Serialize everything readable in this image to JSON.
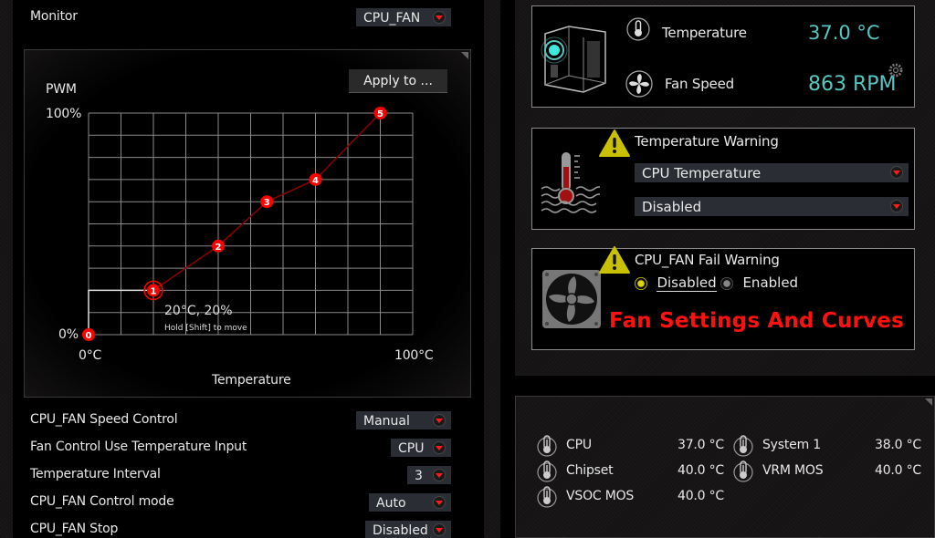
{
  "monitor": {
    "label": "Monitor",
    "selected": "CPU_FAN"
  },
  "curve_panel": {
    "apply_button": "Apply to ...",
    "tooltip_value": "20°C, 20%",
    "tooltip_hint": "Hold [Shift] to move"
  },
  "chart_data": {
    "type": "line",
    "title": "",
    "xlabel": "Temperature",
    "ylabel": "PWM",
    "x_unit": "°C",
    "y_unit": "%",
    "xlim": [
      0,
      100
    ],
    "ylim": [
      0,
      100
    ],
    "x_tick_labels": [
      "0°C",
      "100°C"
    ],
    "y_tick_labels": [
      "100%",
      "0%"
    ],
    "grid": true,
    "grid_divisions": {
      "x": 10,
      "y": 10
    },
    "points": [
      {
        "id": "0",
        "temp": 0,
        "pwm": 0
      },
      {
        "id": "1",
        "temp": 20,
        "pwm": 20,
        "selected": true
      },
      {
        "id": "2",
        "temp": 40,
        "pwm": 40
      },
      {
        "id": "3",
        "temp": 55,
        "pwm": 60
      },
      {
        "id": "4",
        "temp": 70,
        "pwm": 70
      },
      {
        "id": "5",
        "temp": 90,
        "pwm": 100
      }
    ],
    "line_color": "#8b0000",
    "point_color": "#ff0000"
  },
  "settings": [
    {
      "label": "CPU_FAN Speed Control",
      "value": "Manual"
    },
    {
      "label": "Fan Control Use Temperature Input",
      "value": "CPU"
    },
    {
      "label": "Temperature Interval",
      "value": "3"
    },
    {
      "label": "CPU_FAN Control mode",
      "value": "Auto"
    },
    {
      "label": "CPU_FAN Stop",
      "value": "Disabled"
    }
  ],
  "status": {
    "temperature_label": "Temperature",
    "temperature_value": "37.0 °C",
    "fan_speed_label": "Fan Speed",
    "fan_speed_value": "863 RPM"
  },
  "temp_warning": {
    "title": "Temperature Warning",
    "source": "CPU Temperature",
    "threshold": "Disabled"
  },
  "fan_fail_warning": {
    "title": "CPU_FAN Fail Warning",
    "options": [
      "Disabled",
      "Enabled"
    ],
    "selected": "Disabled"
  },
  "overlay_title": "Fan Settings And Curves",
  "sensors": [
    {
      "name": "CPU",
      "value": "37.0 °C"
    },
    {
      "name": "Chipset",
      "value": "40.0 °C"
    },
    {
      "name": "VSOC MOS",
      "value": "40.0 °C"
    },
    {
      "name": "System 1",
      "value": "38.0 °C"
    },
    {
      "name": "VRM MOS",
      "value": "40.0 °C"
    }
  ],
  "colors": {
    "accent": "#ff1010",
    "cyan": "#56c7c2",
    "warning": "#c8c000",
    "dropdown_bg": "#2a2d33"
  }
}
